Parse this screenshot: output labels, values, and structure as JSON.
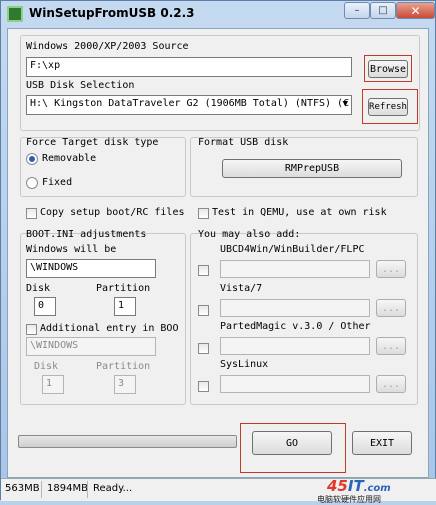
{
  "window": {
    "title": "WinSetupFromUSB 0.2.3",
    "controls": {
      "minimize": "–",
      "maximize": "□",
      "close": "✕"
    }
  },
  "source": {
    "label": "Windows 2000/XP/2003 Source",
    "value": "F:\\xp",
    "browse_label": "Browse"
  },
  "usb": {
    "label": "USB Disk Selection",
    "value": "H:\\ Kingston DataTraveler G2 (1906MB Total) (NTFS) (C",
    "refresh_label": "Refresh"
  },
  "force_target": {
    "title": "Force Target disk type",
    "options": [
      "Removable",
      "Fixed"
    ],
    "selected": "Removable"
  },
  "format_usb": {
    "title": "Format USB disk",
    "button_label": "RMPrepUSB"
  },
  "copy_boot": {
    "label": "Copy setup boot/RC files"
  },
  "qemu": {
    "label": "Test in QEMU, use at own risk"
  },
  "bootini": {
    "title": "BOOT.INI adjustments",
    "windows_label": "Windows will be",
    "windows_value": "\\WINDOWS",
    "disk_label": "Disk",
    "disk_value": "0",
    "partition_label": "Partition",
    "partition_value": "1",
    "additional_label": "Additional entry in BOO",
    "additional_value": "\\WINDOWS",
    "disk2_label": "Disk",
    "disk2_value": "1",
    "partition2_label": "Partition",
    "partition2_value": "3"
  },
  "also_add": {
    "title": "You may also add:",
    "items": [
      {
        "label": "UBCD4Win/WinBuilder/FLPC",
        "browse": "..."
      },
      {
        "label": "Vista/7",
        "browse": "..."
      },
      {
        "label": "PartedMagic v.3.0 / Other",
        "browse": "..."
      },
      {
        "label": "SysLinux",
        "browse": "..."
      }
    ]
  },
  "actions": {
    "go_label": "GO",
    "exit_label": "EXIT"
  },
  "status": {
    "size1": "563MB",
    "size2": "1894MB",
    "state": "Ready..."
  },
  "watermark": {
    "logo_a": "45",
    "logo_b": "IT",
    "logo_c": ".com",
    "sub": "电脑软硬件应用网"
  },
  "colors": {
    "highlight": "#c0392b",
    "titlebar": "#b9d1ea"
  }
}
